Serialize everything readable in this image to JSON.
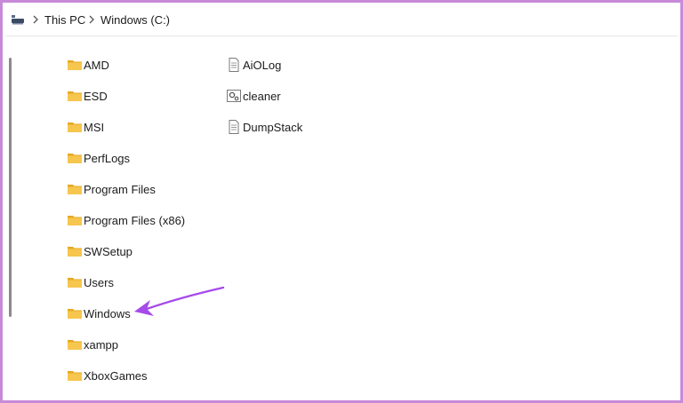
{
  "breadcrumb": {
    "items": [
      "This PC",
      "Windows (C:)"
    ]
  },
  "files": {
    "column1": [
      {
        "name": "AMD",
        "type": "folder"
      },
      {
        "name": "ESD",
        "type": "folder"
      },
      {
        "name": "MSI",
        "type": "folder"
      },
      {
        "name": "PerfLogs",
        "type": "folder"
      },
      {
        "name": "Program Files",
        "type": "folder"
      },
      {
        "name": "Program Files (x86)",
        "type": "folder"
      },
      {
        "name": "SWSetup",
        "type": "folder"
      },
      {
        "name": "Users",
        "type": "folder"
      },
      {
        "name": "Windows",
        "type": "folder"
      },
      {
        "name": "xampp",
        "type": "folder"
      },
      {
        "name": "XboxGames",
        "type": "folder"
      }
    ],
    "column2": [
      {
        "name": "AiOLog",
        "type": "text-file"
      },
      {
        "name": "cleaner",
        "type": "settings-file"
      },
      {
        "name": "DumpStack",
        "type": "text-file"
      }
    ]
  },
  "annotation": {
    "points_to": "Windows",
    "color": "#a64bea"
  },
  "colors": {
    "folder": "#f6c64e",
    "folder_dark": "#e6a822",
    "frame_border": "#c88ad8"
  }
}
